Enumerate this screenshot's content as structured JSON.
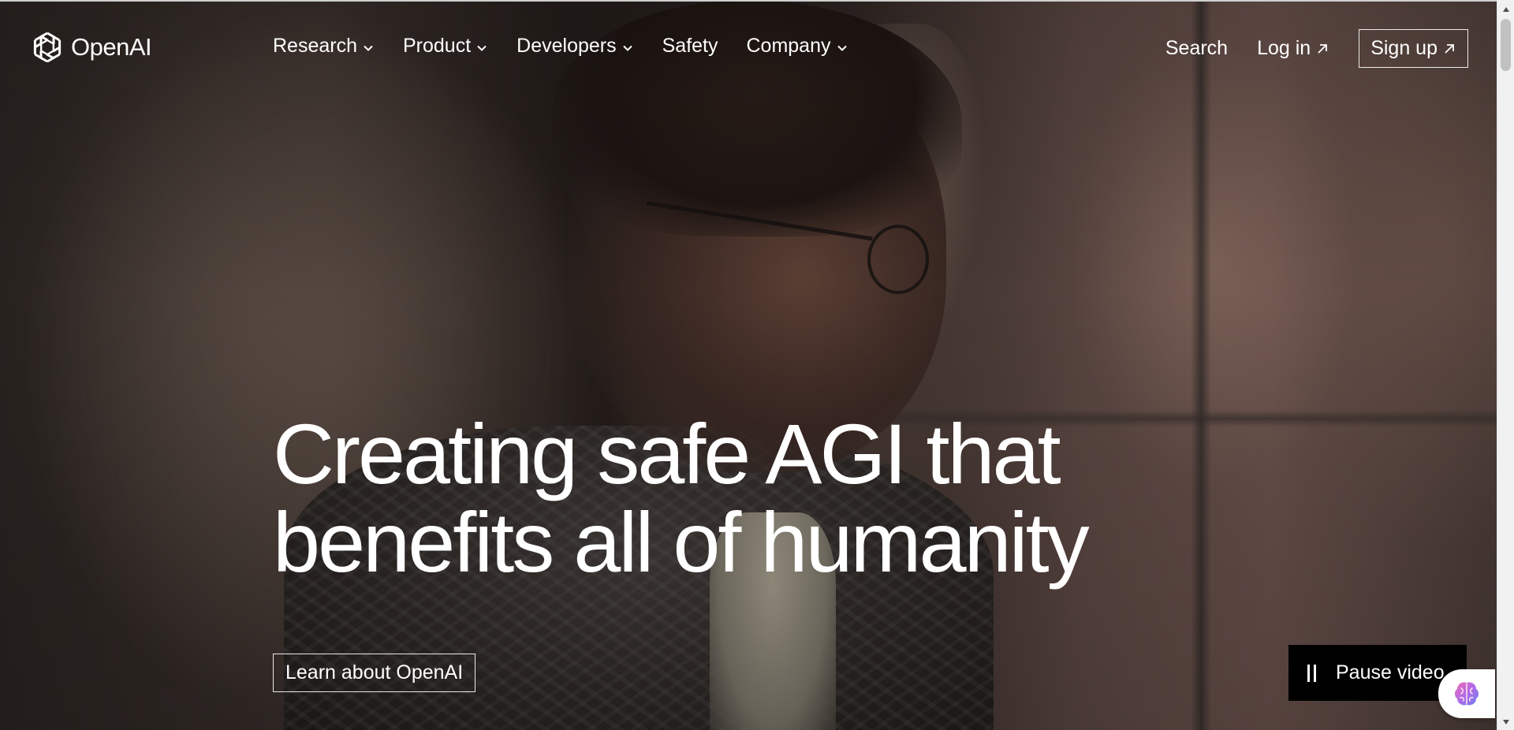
{
  "brand": {
    "name": "OpenAI",
    "logo_icon": "openai-knot-icon"
  },
  "nav": {
    "items": [
      {
        "label": "Research",
        "has_dropdown": true
      },
      {
        "label": "Product",
        "has_dropdown": true
      },
      {
        "label": "Developers",
        "has_dropdown": true
      },
      {
        "label": "Safety",
        "has_dropdown": false
      },
      {
        "label": "Company",
        "has_dropdown": true
      }
    ],
    "search_label": "Search",
    "login_label": "Log in",
    "signup_label": "Sign up"
  },
  "hero": {
    "headline_line1": "Creating safe AGI that",
    "headline_line2": "benefits all of humanity",
    "cta_label": "Learn about OpenAI",
    "pause_label": "Pause video"
  },
  "colors": {
    "text": "#ffffff",
    "pause_button_bg": "#000000",
    "scrollbar_track": "#f1f1f1",
    "scrollbar_thumb": "#c1c1c1"
  },
  "icons": {
    "dropdown": "chevron-down-icon",
    "external_link": "arrow-up-right-icon",
    "pause": "pause-icon",
    "assistant": "brain-icon"
  }
}
